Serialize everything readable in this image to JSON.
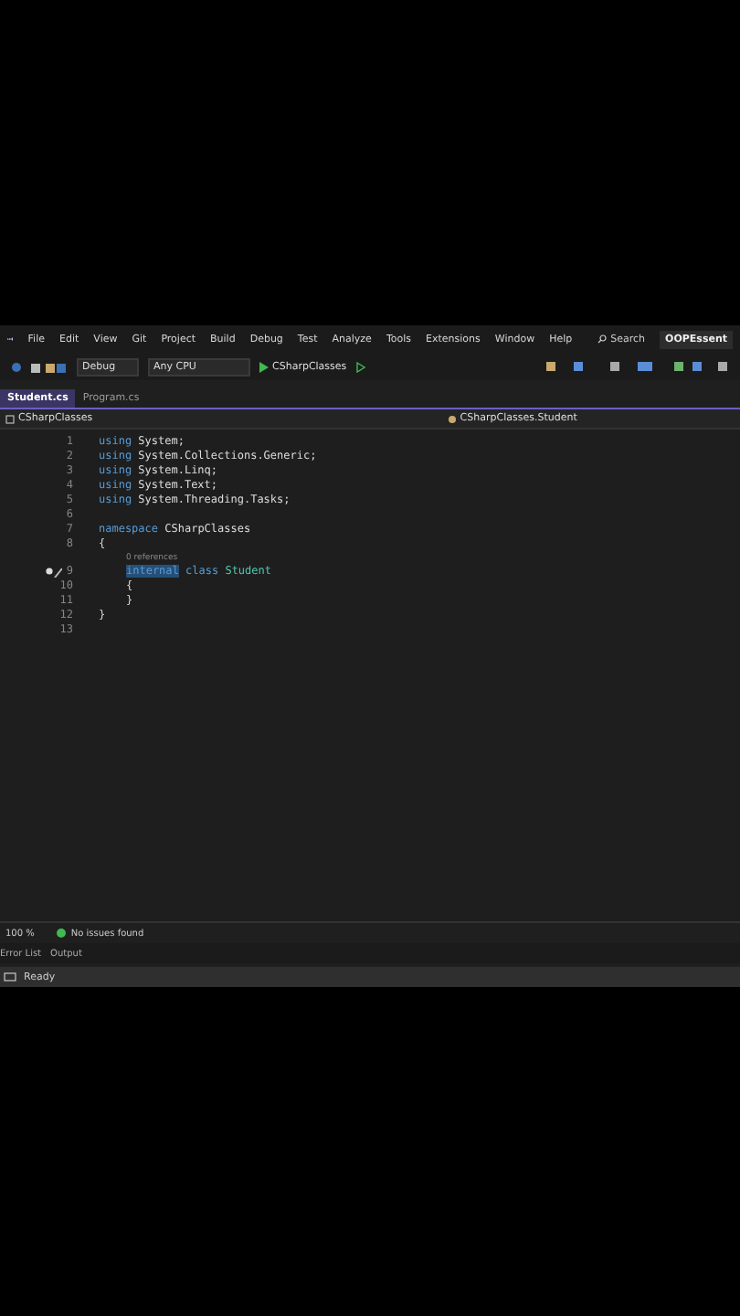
{
  "menu": [
    "File",
    "Edit",
    "View",
    "Git",
    "Project",
    "Build",
    "Debug",
    "Test",
    "Analyze",
    "Tools",
    "Extensions",
    "Window",
    "Help"
  ],
  "search": {
    "label": "Search"
  },
  "solution_title": "OOPEssent",
  "toolbar": {
    "configuration": "Debug",
    "platform": "Any CPU",
    "startup": "CSharpClasses"
  },
  "tabs": [
    {
      "label": "Student.cs",
      "selected": true
    },
    {
      "label": "Program.cs",
      "selected": false
    }
  ],
  "nav": {
    "project": "CSharpClasses",
    "type": "CSharpClasses.Student"
  },
  "lines": [
    {
      "number": "1",
      "tokens": [
        {
          "kind": "keyword",
          "text": "using"
        },
        {
          "kind": "plain",
          "text": " System;"
        }
      ]
    },
    {
      "number": "2",
      "tokens": [
        {
          "kind": "keyword",
          "text": "using"
        },
        {
          "kind": "plain",
          "text": " System.Collections.Generic;"
        }
      ]
    },
    {
      "number": "3",
      "tokens": [
        {
          "kind": "keyword",
          "text": "using"
        },
        {
          "kind": "plain",
          "text": " System.Linq;"
        }
      ]
    },
    {
      "number": "4",
      "tokens": [
        {
          "kind": "keyword",
          "text": "using"
        },
        {
          "kind": "plain",
          "text": " System.Text;"
        }
      ]
    },
    {
      "number": "5",
      "tokens": [
        {
          "kind": "keyword",
          "text": "using"
        },
        {
          "kind": "plain",
          "text": " System.Threading.Tasks;"
        }
      ]
    },
    {
      "number": "6"
    },
    {
      "number": "7",
      "tokens": [
        {
          "kind": "keyword",
          "text": "namespace"
        },
        {
          "kind": "plain",
          "text": " CSharpClasses"
        }
      ]
    },
    {
      "number": "8",
      "tokens": [
        {
          "kind": "plain",
          "text": "{"
        }
      ],
      "children": [
        {
          "number": "9",
          "codelens": "0 references",
          "quick_actions": true,
          "tokens": [
            {
              "kind": "selected",
              "text": "internal"
            },
            {
              "kind": "keyword",
              "text": " class"
            },
            {
              "kind": "type",
              "text": " Student"
            }
          ]
        },
        {
          "number": "10",
          "tokens": [
            {
              "kind": "plain",
              "text": "{"
            }
          ]
        },
        {
          "number": "11",
          "tokens": [
            {
              "kind": "plain",
              "text": "}"
            }
          ]
        }
      ]
    },
    {
      "number": "12",
      "tokens": [
        {
          "kind": "plain",
          "text": "}"
        }
      ]
    },
    {
      "number": "13"
    }
  ],
  "editor_status": {
    "zoom": "100 %",
    "issues": "No issues found"
  },
  "bottom_tabs": [
    "Error List",
    "Output"
  ],
  "status": "Ready"
}
